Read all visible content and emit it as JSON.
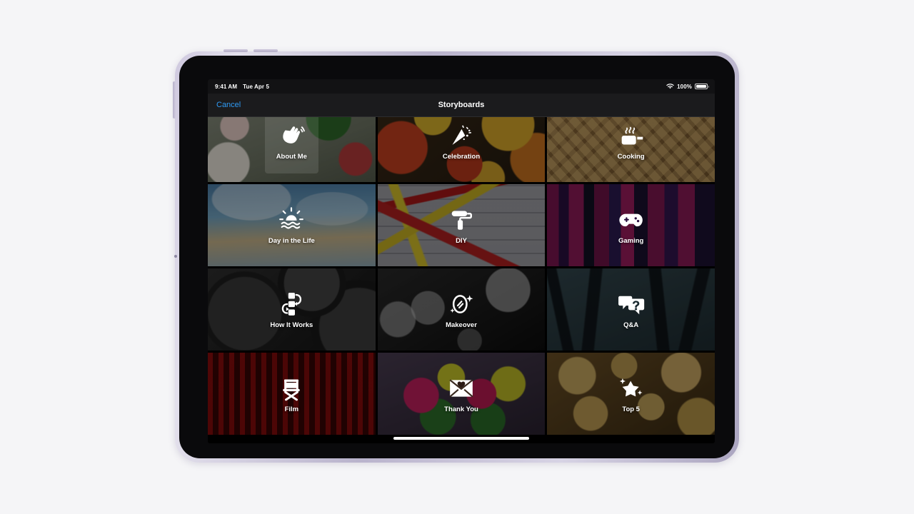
{
  "device": {
    "name": "iPad Air",
    "frame_color": "#c3bdd4"
  },
  "status_bar": {
    "time": "9:41 AM",
    "date": "Tue Apr 5",
    "wifi_icon": "wifi-icon",
    "battery_percent": "100%",
    "battery_icon": "battery-icon"
  },
  "nav": {
    "cancel_label": "Cancel",
    "title": "Storyboards"
  },
  "grid": {
    "tiles": [
      {
        "label": "About Me",
        "icon": "waving-hands-icon",
        "bg": "bg-aboutme",
        "selected": true
      },
      {
        "label": "Celebration",
        "icon": "party-popper-icon",
        "bg": "bg-celebration",
        "selected": false
      },
      {
        "label": "Cooking",
        "icon": "steaming-cup-icon",
        "bg": "bg-cooking",
        "selected": false
      },
      {
        "label": "Day in the Life",
        "icon": "sunrise-water-icon",
        "bg": "bg-dayinlife",
        "selected": false
      },
      {
        "label": "DIY",
        "icon": "paint-roller-icon",
        "bg": "bg-diy",
        "selected": false
      },
      {
        "label": "Gaming",
        "icon": "gamepad-icon",
        "bg": "bg-gaming",
        "selected": false
      },
      {
        "label": "How It Works",
        "icon": "flowchart-icon",
        "bg": "bg-howitworks",
        "selected": false
      },
      {
        "label": "Makeover",
        "icon": "mirror-sparkle-icon",
        "bg": "bg-makeover",
        "selected": false
      },
      {
        "label": "Q&A",
        "icon": "speech-question-icon",
        "bg": "bg-qa",
        "selected": false
      },
      {
        "label": "Film",
        "icon": "director-chair-icon",
        "bg": "bg-film",
        "selected": false
      },
      {
        "label": "Thank You",
        "icon": "heart-envelope-icon",
        "bg": "bg-thankyou",
        "selected": false
      },
      {
        "label": "Top 5",
        "icon": "star-sparkle-icon",
        "bg": "bg-top5",
        "selected": false
      }
    ]
  },
  "home_indicator": {
    "name": "home-indicator"
  },
  "colors": {
    "accent_blue": "#2f9bf5",
    "nav_background": "#1b1b1d",
    "screen_background": "#000000",
    "label_white": "#ffffff"
  }
}
